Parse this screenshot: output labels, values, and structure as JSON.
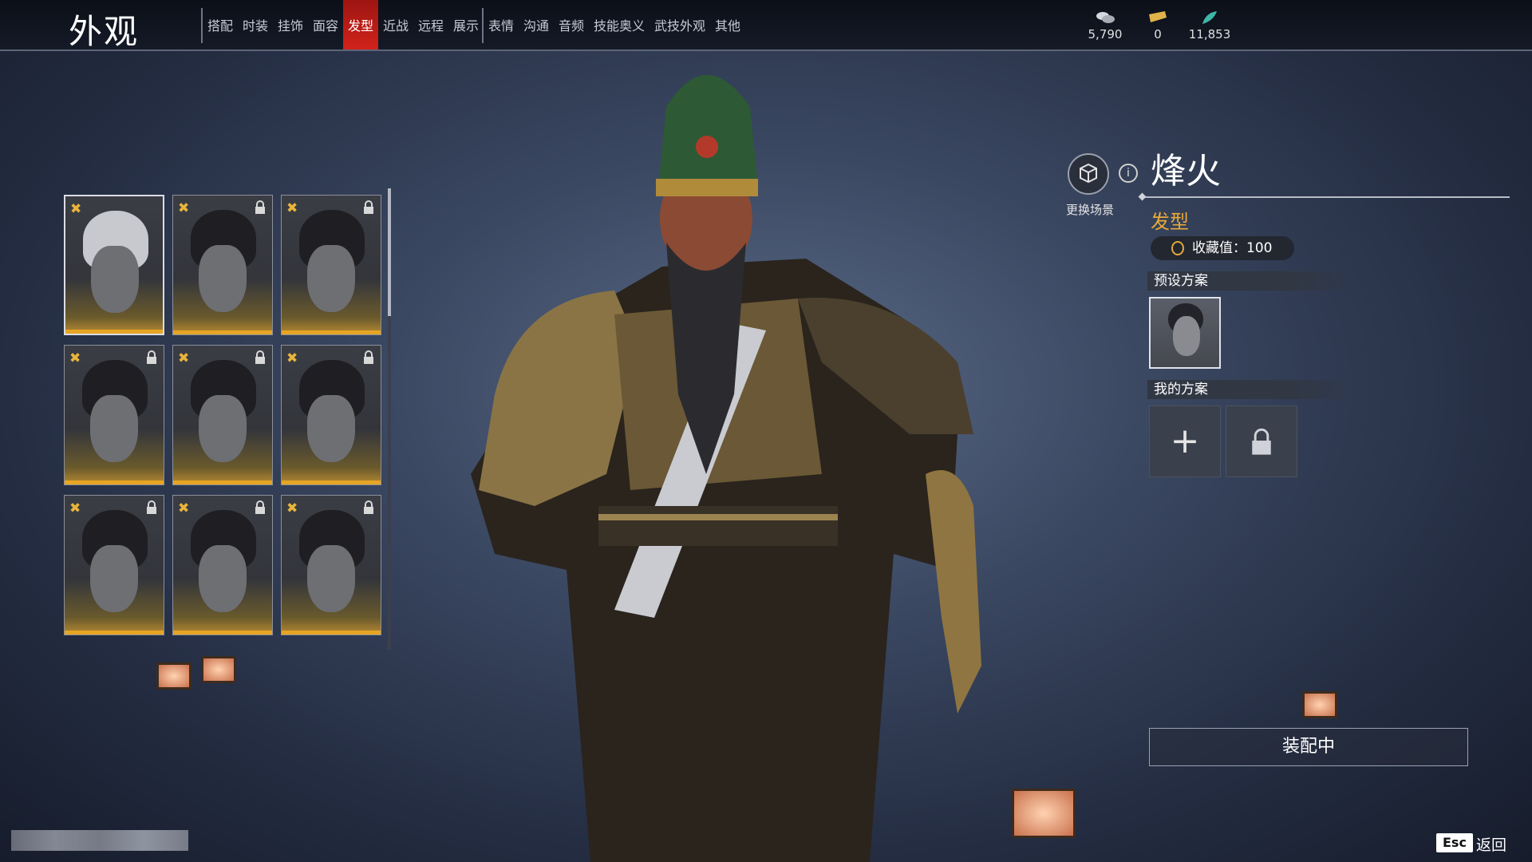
{
  "header": {
    "title": "外观",
    "tabs": [
      {
        "label": "搭配",
        "active": false
      },
      {
        "label": "时装",
        "active": false
      },
      {
        "label": "挂饰",
        "active": false
      },
      {
        "label": "面容",
        "active": false
      },
      {
        "label": "发型",
        "active": true
      },
      {
        "label": "近战",
        "active": false
      },
      {
        "label": "远程",
        "active": false
      },
      {
        "label": "展示",
        "active": false
      },
      {
        "label": "表情",
        "active": false
      },
      {
        "label": "沟通",
        "active": false
      },
      {
        "label": "音频",
        "active": false
      },
      {
        "label": "技能奥义",
        "active": false
      },
      {
        "label": "武技外观",
        "active": false
      },
      {
        "label": "其他",
        "active": false
      }
    ],
    "currencies": [
      {
        "icon": "coin-stack-icon",
        "value": "5,790"
      },
      {
        "icon": "ticket-icon",
        "value": "0"
      },
      {
        "icon": "feather-icon",
        "value": "11,853"
      }
    ]
  },
  "hairstyles": [
    {
      "locked": false,
      "selected": true,
      "hair": "white"
    },
    {
      "locked": true,
      "selected": false,
      "hair": "dark"
    },
    {
      "locked": true,
      "selected": false,
      "hair": "dark"
    },
    {
      "locked": true,
      "selected": false,
      "hair": "dark"
    },
    {
      "locked": true,
      "selected": false,
      "hair": "dark"
    },
    {
      "locked": true,
      "selected": false,
      "hair": "dark"
    },
    {
      "locked": true,
      "selected": false,
      "hair": "dark"
    },
    {
      "locked": true,
      "selected": false,
      "hair": "dark"
    },
    {
      "locked": true,
      "selected": false,
      "hair": "dark"
    }
  ],
  "panel": {
    "scene_label": "更换场景",
    "info_icon": "i",
    "item_name": "烽火",
    "category": "发型",
    "collection": "收藏值：100",
    "preset_header": "预设方案",
    "my_plans_header": "我的方案",
    "add_symbol": "+",
    "equip_label": "装配中"
  },
  "footer": {
    "esc_key": "Esc",
    "back_label": "返回"
  },
  "colors": {
    "accent_red": "#c81f18",
    "gold": "#e7a524",
    "category_orange": "#e8a93a"
  }
}
